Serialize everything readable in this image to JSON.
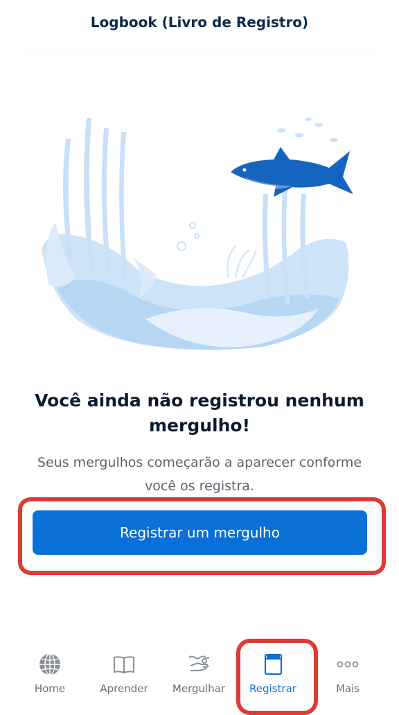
{
  "header": {
    "title": "Logbook (Livro de Registro)"
  },
  "empty_state": {
    "title": "Você ainda não registrou nenhum mergulho!",
    "subtitle": "Seus mergulhos começarão a aparecer conforme você os registra.",
    "cta_label": "Registrar um mergulho"
  },
  "tabs": [
    {
      "label": "Home",
      "icon": "globe-icon",
      "active": false
    },
    {
      "label": "Aprender",
      "icon": "book-icon",
      "active": false
    },
    {
      "label": "Mergulhar",
      "icon": "diver-hand-icon",
      "active": false
    },
    {
      "label": "Registrar",
      "icon": "logbook-icon",
      "active": true
    },
    {
      "label": "Mais",
      "icon": "more-icon",
      "active": false
    }
  ],
  "colors": {
    "primary": "#0b6fd8",
    "highlight": "#e03a36",
    "title": "#0b1a2d",
    "muted": "#6b6f74"
  }
}
